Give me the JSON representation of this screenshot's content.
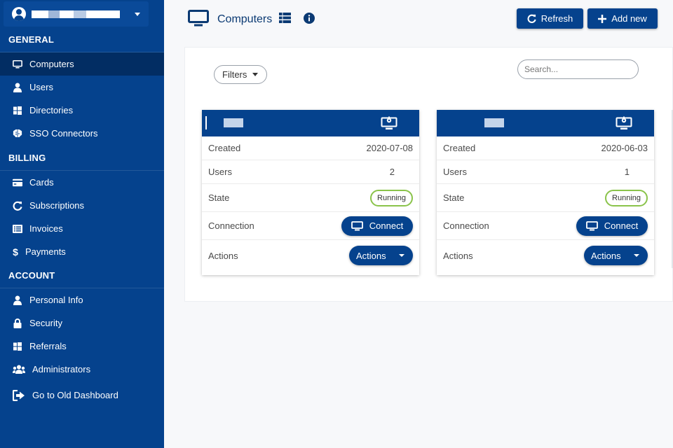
{
  "sidebar": {
    "account": {
      "name": ""
    },
    "sections": [
      {
        "title": "GENERAL"
      },
      {
        "title": "BILLING"
      },
      {
        "title": "ACCOUNT"
      }
    ],
    "items": [
      {
        "label": "Computers",
        "icon": "monitor-icon",
        "active": true
      },
      {
        "label": "Users",
        "icon": "user-icon"
      },
      {
        "label": "Directories",
        "icon": "windows-icon"
      },
      {
        "label": "SSO Connectors",
        "icon": "brain-icon"
      },
      {
        "label": "Cards",
        "icon": "credit-card-icon"
      },
      {
        "label": "Subscriptions",
        "icon": "refresh-icon"
      },
      {
        "label": "Invoices",
        "icon": "list-icon"
      },
      {
        "label": "Payments",
        "icon": "dollar-icon"
      },
      {
        "label": "Personal Info",
        "icon": "user-icon"
      },
      {
        "label": "Security",
        "icon": "lock-icon"
      },
      {
        "label": "Referrals",
        "icon": "windows-icon"
      },
      {
        "label": "Administrators",
        "icon": "users-icon"
      },
      {
        "label": "Go to Old Dashboard",
        "icon": "sign-out-icon"
      }
    ]
  },
  "header": {
    "title": "Computers",
    "refresh_label": "Refresh",
    "add_new_label": "Add new"
  },
  "toolbar": {
    "filters_label": "Filters",
    "search_placeholder": "Search..."
  },
  "cards": [
    {
      "name": "",
      "rows": {
        "created_label": "Created",
        "created_value": "2020-07-08",
        "users_label": "Users",
        "users_value": "2",
        "state_label": "State",
        "state_value": "Running",
        "connection_label": "Connection",
        "connect_label": "Connect",
        "actions_label": "Actions",
        "actions_button": "Actions"
      }
    },
    {
      "name": "",
      "rows": {
        "created_label": "Created",
        "created_value": "2020-06-03",
        "users_label": "Users",
        "users_value": "1",
        "state_label": "State",
        "state_value": "Running",
        "connection_label": "Connection",
        "connect_label": "Connect",
        "actions_label": "Actions",
        "actions_button": "Actions"
      }
    }
  ],
  "colors": {
    "sidebar_bg": "#05428d",
    "sidebar_active": "#022d63",
    "primary": "#05428d",
    "running_border": "#8ac34a",
    "page_bg": "#f7f8fa"
  }
}
